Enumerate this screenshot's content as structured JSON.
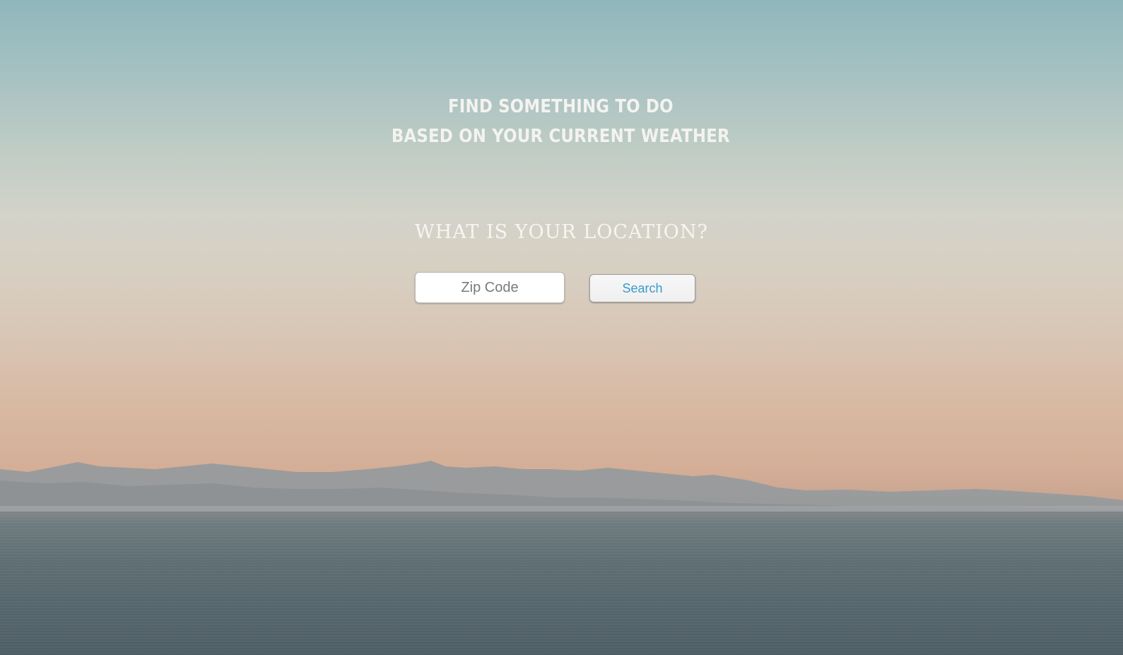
{
  "hero": {
    "headline_line1": "FIND SOMETHING TO DO",
    "headline_line2": "BASED ON YOUR CURRENT WEATHER"
  },
  "location_form": {
    "question": "WHAT IS YOUR LOCATION?",
    "zip_placeholder": "Zip Code",
    "zip_value": "",
    "search_label": "Search"
  },
  "colors": {
    "headline_text": "#f4f3ef",
    "search_text": "#3b99cf",
    "sky_top": "#8fb7bc",
    "sky_horizon": "#d6b29b",
    "water": "#56676d"
  }
}
